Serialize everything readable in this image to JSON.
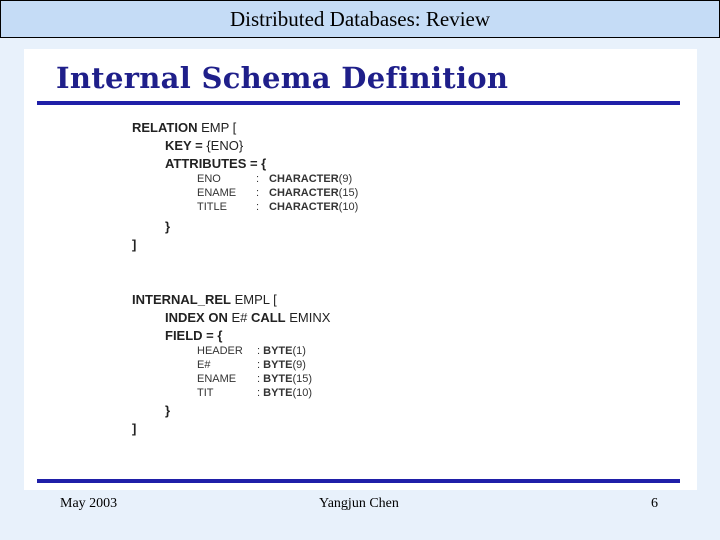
{
  "header": {
    "title": "Distributed Databases: Review"
  },
  "slide": {
    "heading": "Internal Schema Definition",
    "relation": {
      "open_kw": "RELATION",
      "open_rest": " EMP [",
      "key_kw": "KEY = ",
      "key_rest": "{ENO}",
      "attrs_kw": "ATTRIBUTES = {",
      "attributes": [
        {
          "name": "ENO",
          "colon": ":",
          "type_kw": "CHARACTER",
          "size": "(9)"
        },
        {
          "name": "ENAME",
          "colon": ":",
          "type_kw": "CHARACTER",
          "size": "(15)"
        },
        {
          "name": "TITLE",
          "colon": ":",
          "type_kw": "CHARACTER",
          "size": "(10)"
        }
      ],
      "close_brace": "}",
      "close_bracket": "]"
    },
    "internal_rel": {
      "open_kw": "INTERNAL_REL",
      "open_rest": " EMPL [",
      "index_kw1": "INDEX ON",
      "index_mid": " E# ",
      "index_kw2": "CALL",
      "index_rest": " EMINX",
      "field_kw": "FIELD = {",
      "fields": [
        {
          "name": "HEADER",
          "colon": ":",
          "type_kw": "BYTE",
          "size": "(1)"
        },
        {
          "name": "E#",
          "colon": ":",
          "type_kw": "BYTE",
          "size": "(9)"
        },
        {
          "name": "ENAME",
          "colon": ":",
          "type_kw": "BYTE",
          "size": "(15)"
        },
        {
          "name": "TIT",
          "colon": ":",
          "type_kw": "BYTE",
          "size": "(10)"
        }
      ],
      "close_brace": "}",
      "close_bracket": "]"
    }
  },
  "footer": {
    "date": "May 2003",
    "author": "Yangjun Chen",
    "page": "6"
  }
}
